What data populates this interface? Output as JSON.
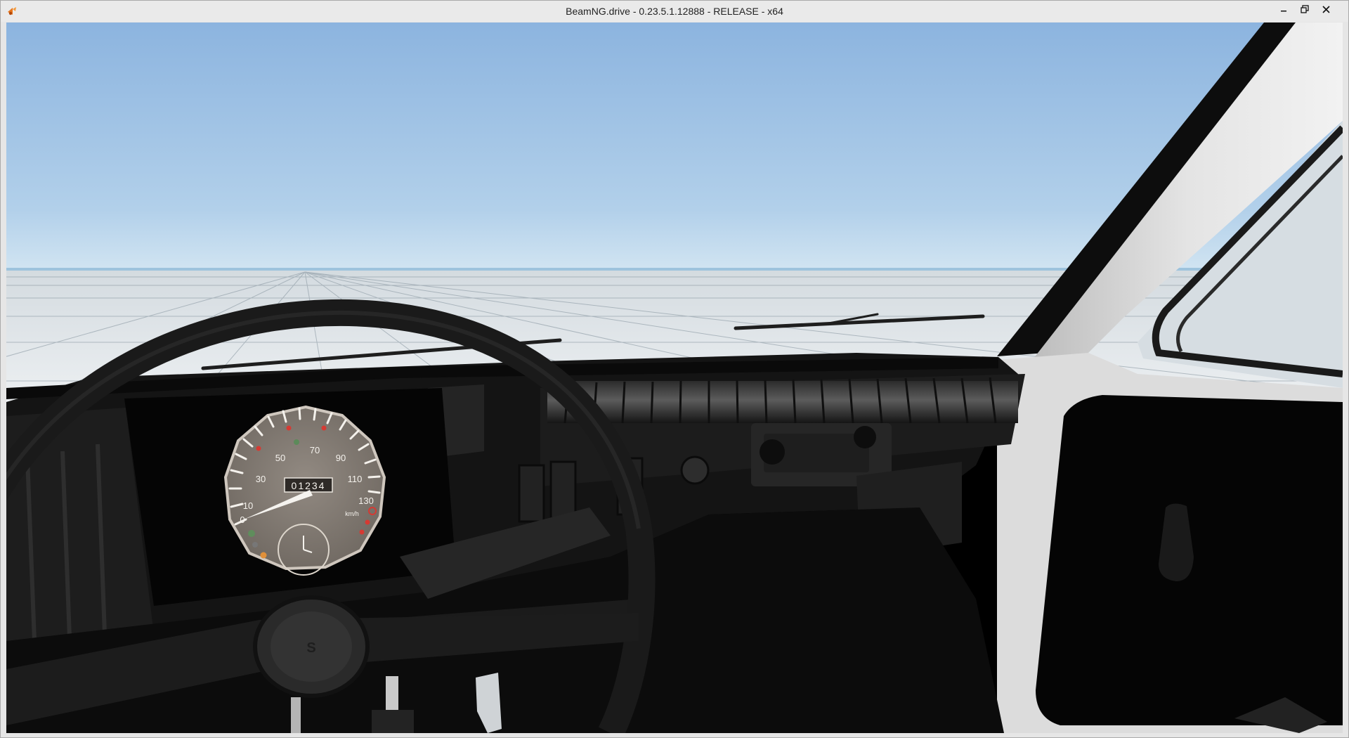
{
  "window": {
    "title": "BeamNG.drive - 0.23.5.1.12888 - RELEASE - x64",
    "controls": [
      "minimize",
      "maximize",
      "close"
    ]
  },
  "icons": {
    "app": "beamng-app-icon",
    "minimize": "minimize-icon",
    "maximize": "maximize-icon",
    "close": "close-icon"
  },
  "speedometer": {
    "tick_labels": [
      "0",
      "10",
      "30",
      "50",
      "70",
      "90",
      "110",
      "130"
    ],
    "unit": "km/h",
    "odometer": "01234",
    "speed_value": 0
  },
  "colors": {
    "sky_top": "#8cb4df",
    "sky_horizon": "#cfe3f2",
    "floor": "#e4e9ec",
    "dashboard": "#151515",
    "gauge_face": "#8a8179",
    "pillar": "#dadada"
  }
}
